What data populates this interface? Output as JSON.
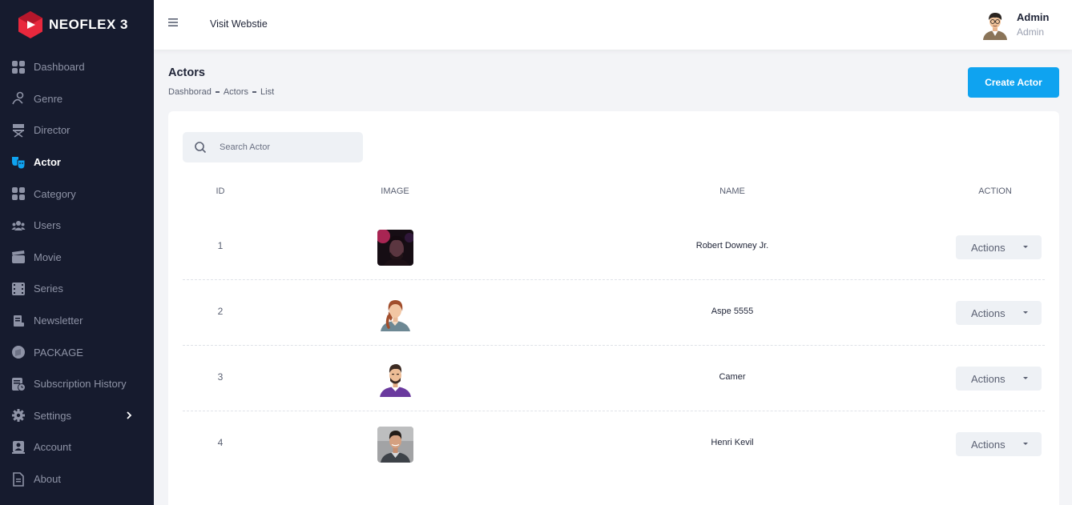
{
  "brand": {
    "name": "NEOFLEX 3",
    "logo_colors": [
      "#e8283d",
      "#b5172b"
    ]
  },
  "sidebar": {
    "items": [
      {
        "label": "Dashboard",
        "icon": "dashboard-icon",
        "active": false
      },
      {
        "label": "Genre",
        "icon": "genre-icon",
        "active": false
      },
      {
        "label": "Director",
        "icon": "director-chair-icon",
        "active": false
      },
      {
        "label": "Actor",
        "icon": "actor-masks-icon",
        "active": true
      },
      {
        "label": "Category",
        "icon": "category-icon",
        "active": false
      },
      {
        "label": "Users",
        "icon": "users-icon",
        "active": false
      },
      {
        "label": "Movie",
        "icon": "movie-clapper-icon",
        "active": false
      },
      {
        "label": "Series",
        "icon": "series-film-icon",
        "active": false
      },
      {
        "label": "Newsletter",
        "icon": "newsletter-icon",
        "active": false
      },
      {
        "label": "PACKAGE",
        "icon": "package-icon",
        "active": false
      },
      {
        "label": "Subscription History",
        "icon": "subscription-history-icon",
        "active": false
      },
      {
        "label": "Settings",
        "icon": "gear-icon",
        "active": false,
        "has_submenu": true
      },
      {
        "label": "Account",
        "icon": "account-icon",
        "active": false
      },
      {
        "label": "About",
        "icon": "about-document-icon",
        "active": false
      }
    ]
  },
  "header": {
    "visit_label": "Visit Webstie",
    "user": {
      "name": "Admin",
      "role": "Admin"
    }
  },
  "page": {
    "title": "Actors",
    "breadcrumb": [
      "Dashborad",
      "Actors",
      "List"
    ],
    "create_label": "Create Actor"
  },
  "search": {
    "placeholder": "Search Actor",
    "value": ""
  },
  "table": {
    "columns": [
      "ID",
      "IMAGE",
      "NAME",
      "ACTION"
    ],
    "rows": [
      {
        "id": "1",
        "name": "Robert Downey Jr.",
        "image": "actor-photo-dark",
        "action": "Actions"
      },
      {
        "id": "2",
        "name": "Aspe 5555",
        "image": "female-avatar",
        "action": "Actions"
      },
      {
        "id": "3",
        "name": "Camer",
        "image": "male-avatar-purple",
        "action": "Actions"
      },
      {
        "id": "4",
        "name": "Henri Kevil",
        "image": "actor-photo-portrait",
        "action": "Actions"
      }
    ]
  },
  "colors": {
    "sidebar_bg": "#161b2e",
    "accent": "#0fa3f0",
    "active_icon": "#0fa3f0",
    "page_bg": "#f3f4f7"
  }
}
